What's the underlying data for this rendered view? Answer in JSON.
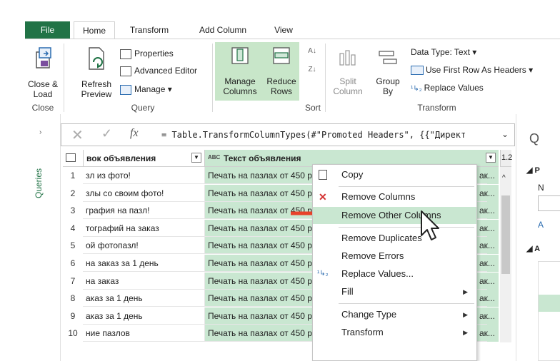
{
  "tabs": [
    {
      "label": "File"
    },
    {
      "label": "Home"
    },
    {
      "label": "Transform"
    },
    {
      "label": "Add Column"
    },
    {
      "label": "View"
    }
  ],
  "ribbon": {
    "close_load": "Close &\nLoad",
    "close_group": "Close",
    "refresh_preview": "Refresh\nPreview",
    "properties": "Properties",
    "advanced_editor": "Advanced Editor",
    "manage": "Manage",
    "query_group": "Query",
    "manage_columns": "Manage\nColumns",
    "reduce_rows": "Reduce\nRows",
    "sort_group": "Sort",
    "split_column": "Split\nColumn",
    "group_by": "Group\nBy",
    "data_type": "Data Type: Text",
    "use_first_row": "Use First Row As Headers",
    "replace_values": "Replace Values",
    "transform_group": "Transform"
  },
  "queries_label": "Queries",
  "formula": {
    "fx": "fx",
    "text": "= Table.TransformColumnTypes(#\"Promoted Headers\", {{\"Директ"
  },
  "columns": [
    {
      "type_icon": "",
      "name": "вок объявления"
    },
    {
      "type_icon": "ABC",
      "name": "Текст объявления"
    },
    {
      "name": "1.2"
    }
  ],
  "rows": [
    {
      "n": "1",
      "c1": "зл из фото!",
      "c2": "Печать на пазлах от 450 р"
    },
    {
      "n": "2",
      "c1": "злы со своим фото!",
      "c2": "Печать на пазлах от 450 р"
    },
    {
      "n": "3",
      "c1": "графия на пазл!",
      "c2": "Печать на пазлах от 450 р"
    },
    {
      "n": "4",
      "c1": "тографий на заказ",
      "c2": "Печать на пазлах от 450 р"
    },
    {
      "n": "5",
      "c1": "ой фотопазл!",
      "c2": "Печать на пазлах от 450 р"
    },
    {
      "n": "6",
      "c1": "на заказ за 1 день",
      "c2": "Печать на пазлах от 450 р"
    },
    {
      "n": "7",
      "c1": "на заказ",
      "c2": "Печать на пазлах от 450 р"
    },
    {
      "n": "8",
      "c1": "аказ за 1 день",
      "c2": "Печать на пазлах от 450 р"
    },
    {
      "n": "9",
      "c1": "аказ за 1 день",
      "c2": "Печать на пазлах от 450 р"
    },
    {
      "n": "10",
      "c1": "ние пазлов",
      "c2": "Печать на пазлах от 450 р"
    }
  ],
  "row_tail": "ак...",
  "context_menu": {
    "items": [
      {
        "label": "Copy"
      },
      {
        "label": "Remove Columns"
      },
      {
        "label": "Remove Other Columns"
      },
      {
        "label": "Remove Duplicates"
      },
      {
        "label": "Remove Errors"
      },
      {
        "label": "Replace Values..."
      },
      {
        "label": "Fill"
      },
      {
        "label": "Change Type"
      },
      {
        "label": "Transform"
      }
    ]
  },
  "right_panel": {
    "q": "Q",
    "p": "P",
    "n": "N",
    "a1": "A",
    "a2": "A"
  },
  "colors": {
    "accent": "#217346",
    "hover": "#c9e7d1",
    "arrow": "#e8412a"
  }
}
